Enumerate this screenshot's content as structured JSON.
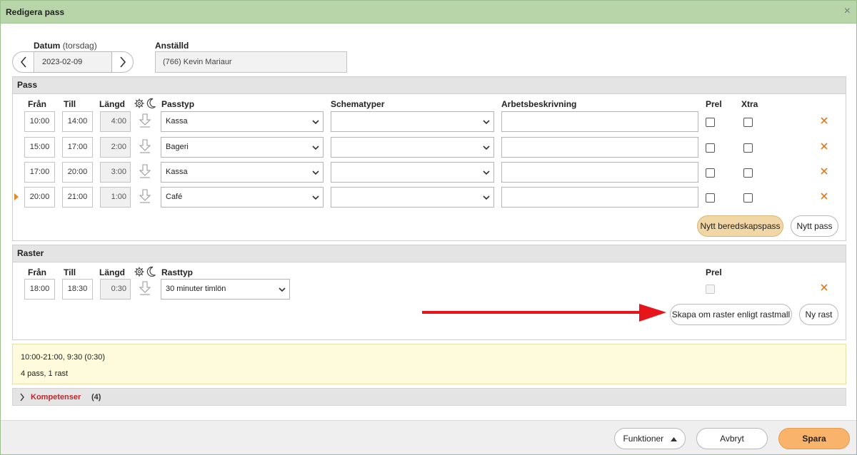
{
  "dialog": {
    "title": "Redigera pass",
    "close_symbol": "×"
  },
  "date": {
    "label": "Datum",
    "weekday": "(torsdag)",
    "value": "2023-02-09"
  },
  "employee": {
    "label": "Anställd",
    "value": "(766) Kevin Mariaur"
  },
  "pass_section": {
    "title": "Pass",
    "headers": {
      "from": "Från",
      "to": "Till",
      "length": "Längd",
      "type": "Passtyp",
      "schedule": "Schematyper",
      "description": "Arbetsbeskrivning",
      "prel": "Prel",
      "xtra": "Xtra"
    },
    "rows": [
      {
        "from": "10:00",
        "to": "14:00",
        "length": "4:00",
        "type": "Kassa",
        "schedule": "",
        "description": ""
      },
      {
        "from": "15:00",
        "to": "17:00",
        "length": "2:00",
        "type": "Bageri",
        "schedule": "",
        "description": ""
      },
      {
        "from": "17:00",
        "to": "20:00",
        "length": "3:00",
        "type": "Kassa",
        "schedule": "",
        "description": ""
      },
      {
        "from": "20:00",
        "to": "21:00",
        "length": "1:00",
        "type": "Café",
        "schedule": "",
        "description": ""
      }
    ],
    "buttons": {
      "standby": "Nytt beredskapspass",
      "new": "Nytt pass"
    }
  },
  "breaks_section": {
    "title": "Raster",
    "headers": {
      "from": "Från",
      "to": "Till",
      "length": "Längd",
      "type": "Rasttyp",
      "prel": "Prel"
    },
    "rows": [
      {
        "from": "18:00",
        "to": "18:30",
        "length": "0:30",
        "type": "30 minuter timlön"
      }
    ],
    "buttons": {
      "recreate": "Skapa om raster enligt rastmall",
      "new": "Ny rast"
    }
  },
  "summary": {
    "line1": "10:00-21:00, 9:30 (0:30)",
    "line2": "4 pass, 1 rast"
  },
  "competences": {
    "label": "Kompetenser",
    "count": "(4)"
  },
  "footer": {
    "functions": "Funktioner",
    "cancel": "Avbryt",
    "save": "Spara"
  },
  "colors": {
    "title_bar": "#b8d5a9",
    "save_button": "#f9b36a",
    "standby_button": "#f2d7a6",
    "delete_x": "#e07a1f",
    "annotation_arrow": "#e8141b",
    "competences_label": "#c0272d",
    "summary_bg": "#fdfbdc"
  },
  "icons": {
    "date_prev": "chevron-left-icon",
    "date_next": "chevron-right-icon",
    "copy_down": "arrow-down-icon",
    "settings": "gear-icon",
    "night": "moon-icon",
    "remove": "close-icon",
    "current_row": "caret-right-icon",
    "expand": "chevron-right-icon",
    "menu": "caret-up-icon"
  }
}
